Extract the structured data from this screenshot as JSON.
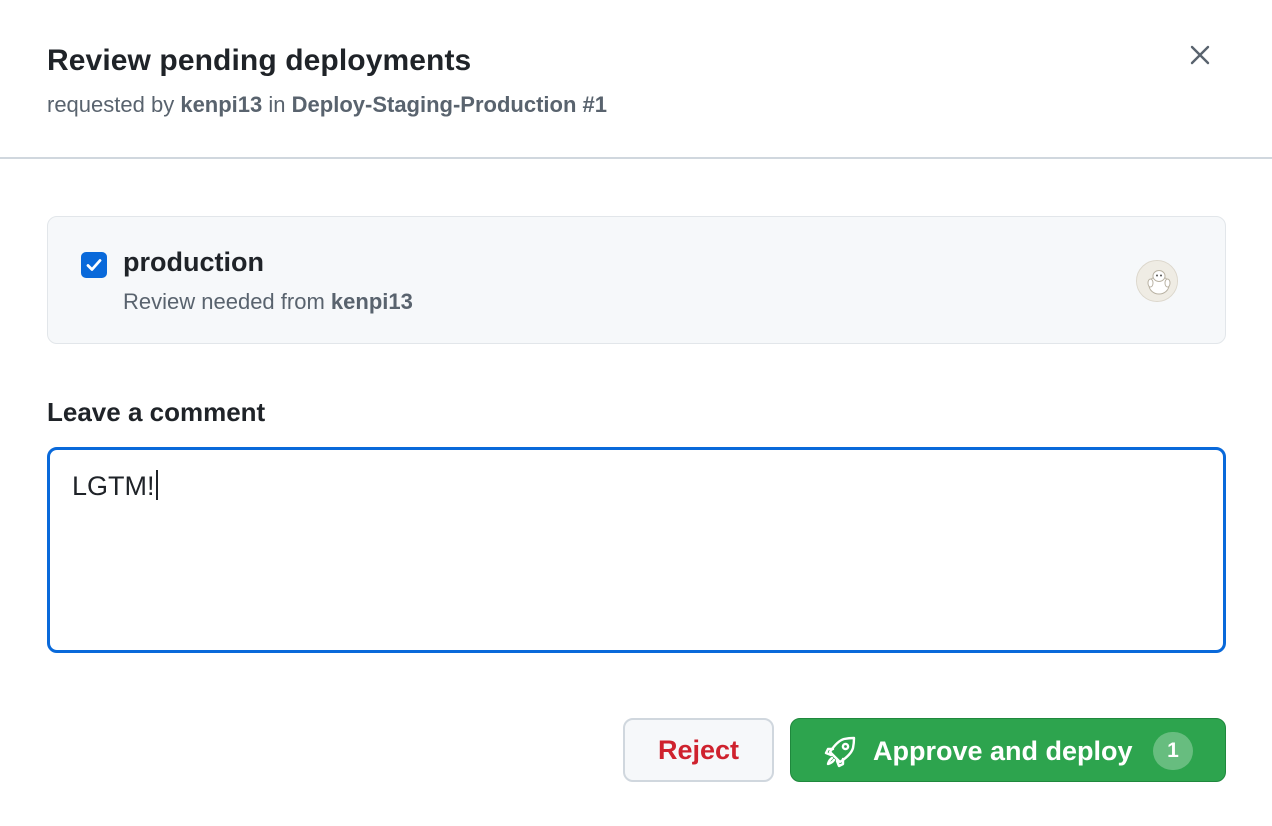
{
  "dialog": {
    "title": "Review pending deployments",
    "subtitle": {
      "prefix": "requested by",
      "user": "kenpi13",
      "connector": "in",
      "workflow": "Deploy-Staging-Production #1"
    },
    "close_icon": "close-icon"
  },
  "environment": {
    "checked": true,
    "name": "production",
    "review_prefix": "Review needed from",
    "reviewer": "kenpi13",
    "avatar_icon": "avatar"
  },
  "comment": {
    "label": "Leave a comment",
    "value": "LGTM!"
  },
  "actions": {
    "reject_label": "Reject",
    "approve_label": "Approve and deploy",
    "approve_count": "1",
    "approve_icon": "rocket-icon"
  },
  "colors": {
    "accent_blue": "#0969da",
    "approve_green": "#2da44e",
    "reject_red": "#cf222e"
  }
}
